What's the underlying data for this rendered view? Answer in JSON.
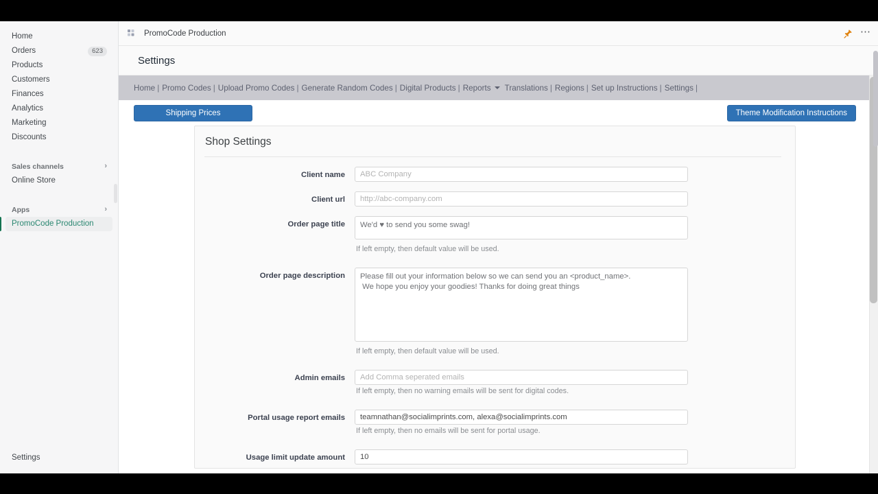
{
  "sidebar": {
    "primary_items": [
      {
        "label": "Home",
        "badge": ""
      },
      {
        "label": "Orders",
        "badge": "623"
      },
      {
        "label": "Products",
        "badge": ""
      },
      {
        "label": "Customers",
        "badge": ""
      },
      {
        "label": "Finances",
        "badge": ""
      },
      {
        "label": "Analytics",
        "badge": ""
      },
      {
        "label": "Marketing",
        "badge": ""
      },
      {
        "label": "Discounts",
        "badge": ""
      }
    ],
    "sales_channels": {
      "label": "Sales channels",
      "chevron": "›"
    },
    "online_store": {
      "label": "Online Store"
    },
    "apps": {
      "label": "Apps",
      "chevron": "›"
    },
    "active_app": {
      "label": "PromoCode Production"
    },
    "footer": {
      "label": "Settings"
    }
  },
  "appbar": {
    "title": "PromoCode Production",
    "app_icon": "apps-grid-icon",
    "pin_icon": "pushpin-icon",
    "more_icon": "ellipsis-icon",
    "pin_color": "#e0820f"
  },
  "page": {
    "title": "Settings"
  },
  "appnav": {
    "separator": "|",
    "items": [
      {
        "label": "Home",
        "dropdown": false
      },
      {
        "label": "Promo Codes",
        "dropdown": false
      },
      {
        "label": "Upload Promo Codes",
        "dropdown": false
      },
      {
        "label": "Generate Random Codes",
        "dropdown": false
      },
      {
        "label": "Digital Products",
        "dropdown": false
      },
      {
        "label": "Reports",
        "dropdown": true
      },
      {
        "label": "Translations",
        "dropdown": false
      },
      {
        "label": "Regions",
        "dropdown": false
      },
      {
        "label": "Set up Instructions",
        "dropdown": false
      },
      {
        "label": "Settings",
        "dropdown": false
      }
    ]
  },
  "toolbar": {
    "shipping_prices_label": "Shipping Prices",
    "theme_instructions_label": "Theme Modification Instructions",
    "button_color": "#2f72b5"
  },
  "card": {
    "title": "Shop Settings",
    "fields": [
      {
        "label": "Client name",
        "type": "input",
        "value": "",
        "placeholder": "ABC Company",
        "hint": ""
      },
      {
        "label": "Client url",
        "type": "input",
        "value": "",
        "placeholder": "http://abc-company.com",
        "hint": ""
      },
      {
        "label": "Order page title",
        "type": "textarea-small",
        "value": "We'd ♥ to send you some swag!",
        "placeholder": "",
        "hint": "If left empty, then default value will be used."
      },
      {
        "label": "Order page description",
        "type": "textarea-large",
        "value": "Please fill out your information below so we can send you an <product_name>.\n We hope you enjoy your goodies! Thanks for doing great things",
        "placeholder": "",
        "hint": "If left empty, then default value will be used."
      },
      {
        "label": "Admin emails",
        "type": "input",
        "value": "",
        "placeholder": "Add Comma seperated emails",
        "hint": "If left empty, then no warning emails will be sent for digital codes."
      },
      {
        "label": "Portal usage report emails",
        "type": "input",
        "value": "teamnathan@socialimprints.com, alexa@socialimprints.com",
        "placeholder": "",
        "hint": "If left empty, then no emails will be sent for portal usage."
      },
      {
        "label": "Usage limit update amount",
        "type": "input",
        "value": "10",
        "placeholder": "",
        "hint": ""
      }
    ]
  },
  "scrollbars": {
    "frame_scroll_arrow": "▲"
  }
}
